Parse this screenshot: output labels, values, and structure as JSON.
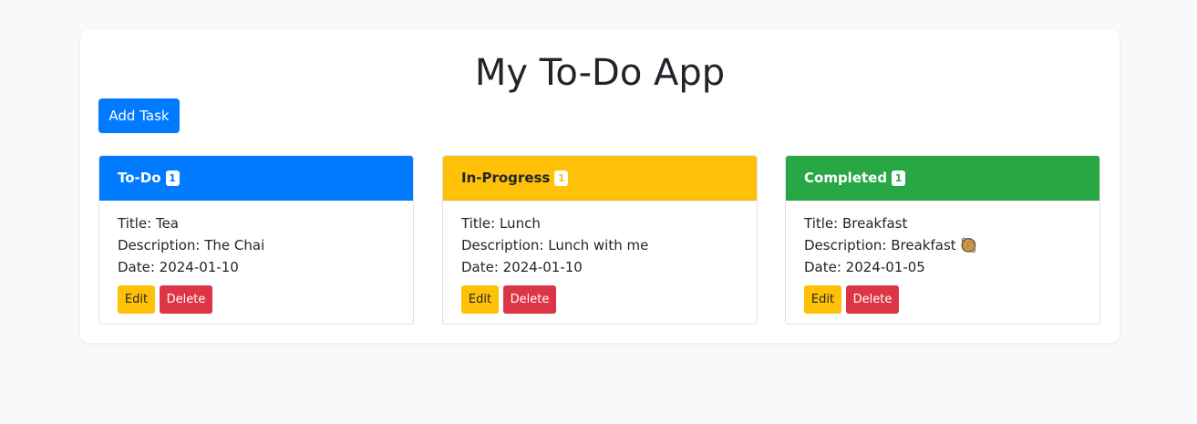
{
  "app": {
    "title": "My To-Do App",
    "add_task_label": "Add Task"
  },
  "colors": {
    "todo": "#007bff",
    "in_progress": "#ffc107",
    "completed": "#28a745",
    "edit": "#ffc107",
    "delete": "#dc3545"
  },
  "columns": [
    {
      "name": "To-Do",
      "count": "1",
      "tasks": [
        {
          "title_line": "Title: Tea",
          "description_line": "Description: The Chai",
          "date_line": "Date: 2024-01-10",
          "edit_label": "Edit",
          "delete_label": "Delete"
        }
      ]
    },
    {
      "name": "In-Progress",
      "count": "1",
      "tasks": [
        {
          "title_line": "Title: Lunch",
          "description_line": "Description: Lunch with me",
          "date_line": "Date: 2024-01-10",
          "edit_label": "Edit",
          "delete_label": "Delete"
        }
      ]
    },
    {
      "name": "Completed",
      "count": "1",
      "tasks": [
        {
          "title_line": "Title: Breakfast",
          "description_line": "Description: Breakfast 🥘",
          "date_line": "Date: 2024-01-05",
          "edit_label": "Edit",
          "delete_label": "Delete"
        }
      ]
    }
  ]
}
